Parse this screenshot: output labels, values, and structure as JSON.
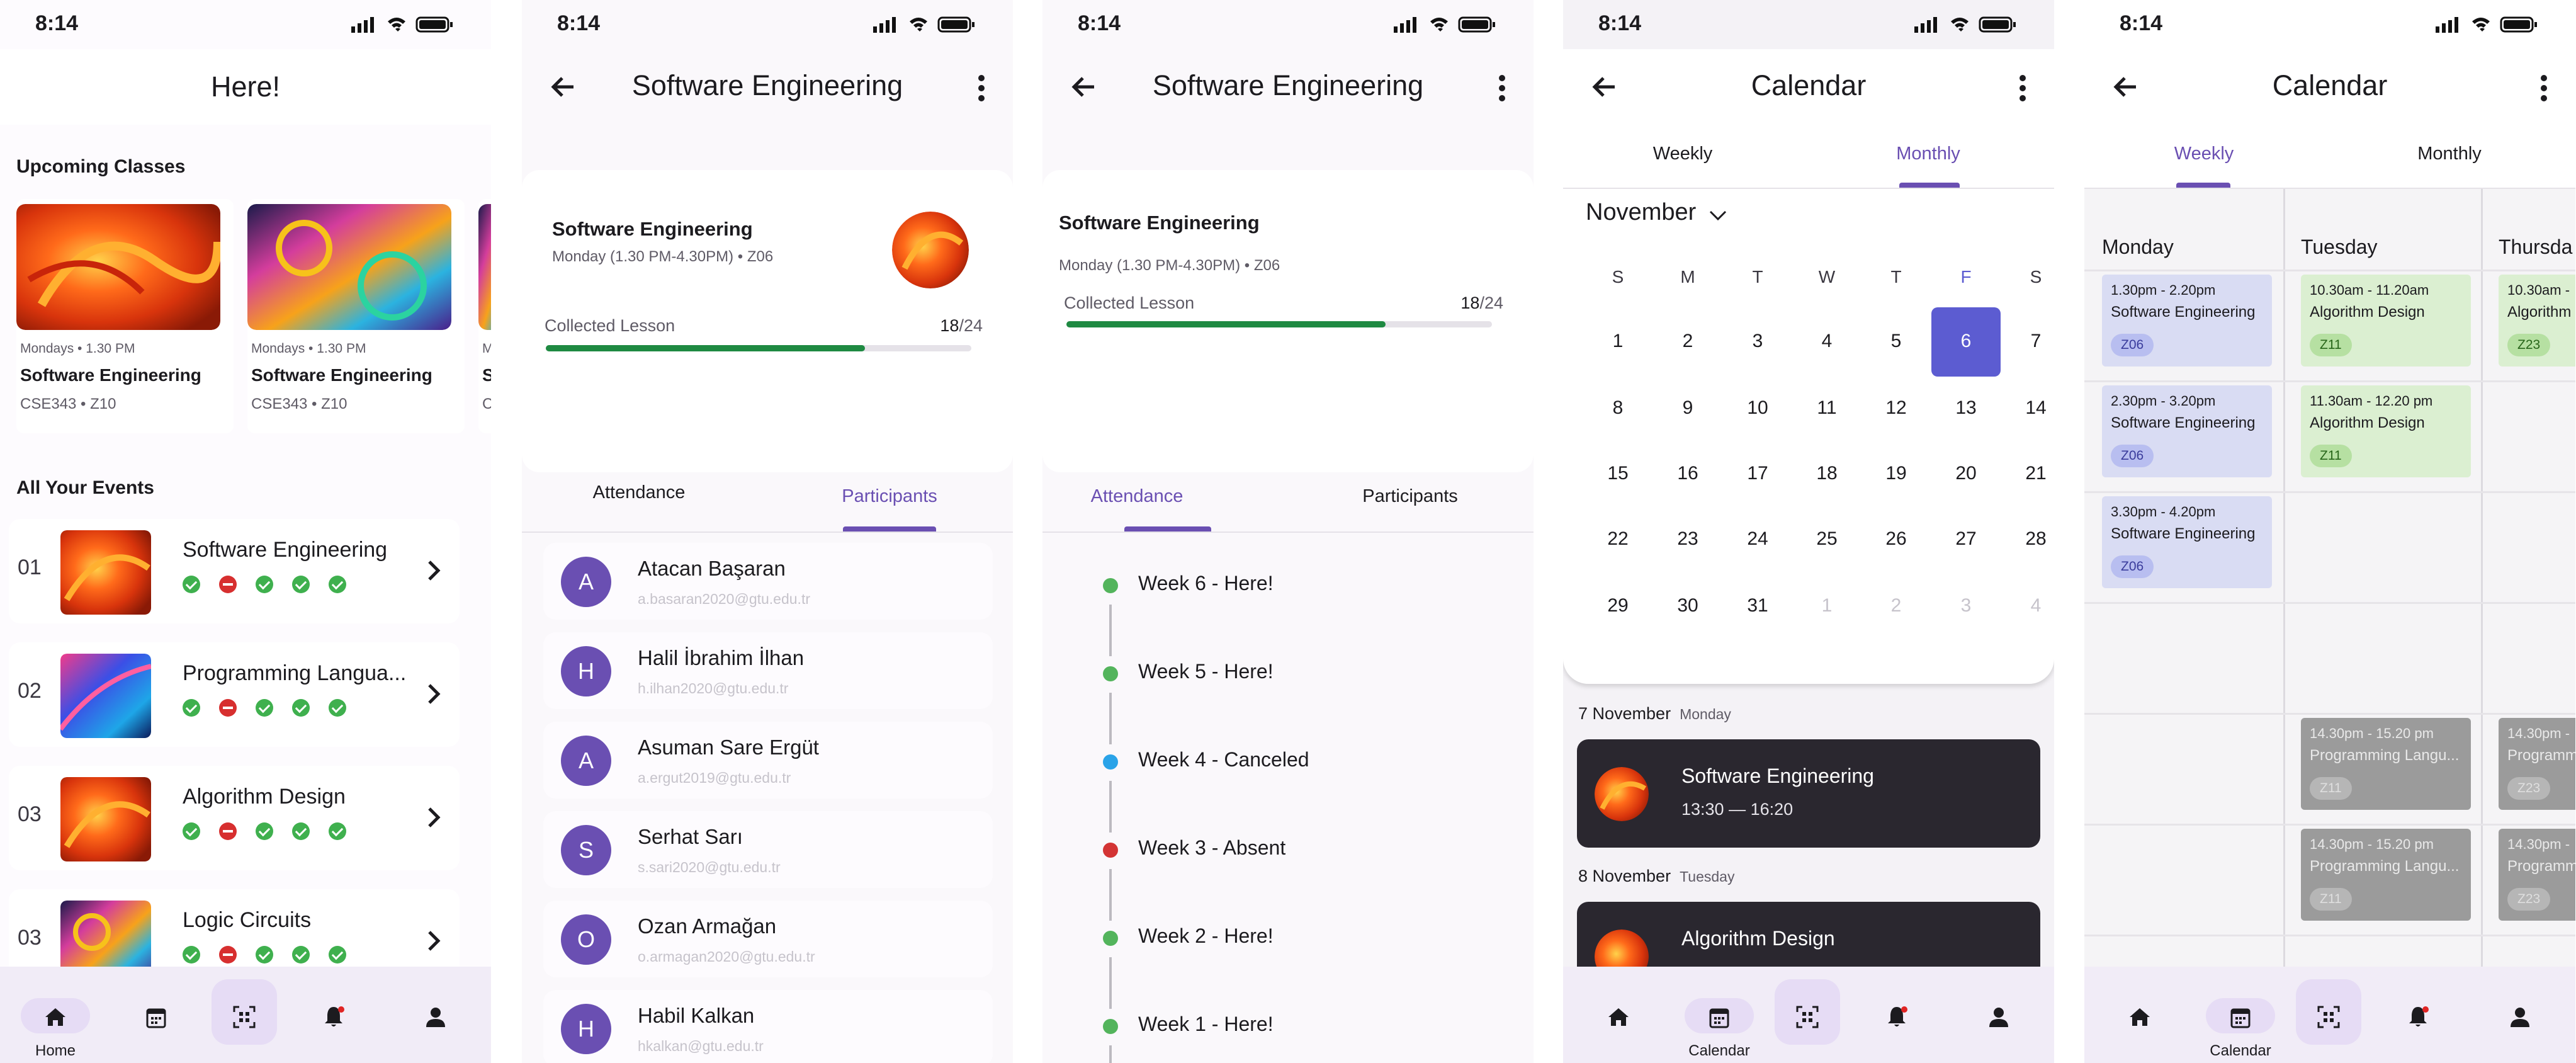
{
  "status_time": "8:14",
  "nav": {
    "home": "Home",
    "calendar": "Calendar"
  },
  "screen1": {
    "title": "Here!",
    "upcoming_title": "Upcoming Classes",
    "events_title": "All Your Events",
    "upcoming": [
      {
        "time": "Mondays • 1.30 PM",
        "name": "Software Engineering",
        "code": "CSE343 • Z10"
      },
      {
        "time": "Mondays • 1.30 PM",
        "name": "Software Engineering",
        "code": "CSE343 • Z10"
      },
      {
        "time": "M",
        "name": "S",
        "code": "C"
      }
    ],
    "events": [
      {
        "num": "01",
        "name": "Software Engineering",
        "marks": [
          "ok",
          "no",
          "ok",
          "ok",
          "ok"
        ]
      },
      {
        "num": "02",
        "name": "Programming Langua...",
        "marks": [
          "ok",
          "no",
          "ok",
          "ok",
          "ok"
        ]
      },
      {
        "num": "03",
        "name": "Algorithm Design",
        "marks": [
          "ok",
          "no",
          "ok",
          "ok",
          "ok"
        ]
      },
      {
        "num": "03",
        "name": "Logic Circuits",
        "marks": [
          "ok",
          "no",
          "ok",
          "ok",
          "ok"
        ]
      }
    ]
  },
  "course": {
    "title": "Software Engineering",
    "name": "Software Engineering",
    "schedule": "Monday (1.30 PM-4.30PM) • Z06",
    "collected_label": "Collected Lesson",
    "collected": "18",
    "total": "/24",
    "progress": 0.75
  },
  "tabs": {
    "attendance": "Attendance",
    "participants": "Participants"
  },
  "participants": [
    {
      "initial": "A",
      "name": "Atacan Başaran",
      "email": "a.basaran2020@gtu.edu.tr"
    },
    {
      "initial": "H",
      "name": "Halil İbrahim İlhan",
      "email": "h.ilhan2020@gtu.edu.tr"
    },
    {
      "initial": "A",
      "name": "Asuman Sare Ergüt",
      "email": "a.ergut2019@gtu.edu.tr"
    },
    {
      "initial": "S",
      "name": "Serhat Sarı",
      "email": "s.sari2020@gtu.edu.tr"
    },
    {
      "initial": "O",
      "name": "Ozan Armağan",
      "email": "o.armagan2020@gtu.edu.tr"
    },
    {
      "initial": "H",
      "name": "Habil Kalkan",
      "email": "hkalkan@gtu.edu.tr"
    }
  ],
  "attendance": [
    {
      "label": "Week 6 - Here!",
      "status": "here",
      "color": "#53b45c"
    },
    {
      "label": "Week 5 - Here!",
      "status": "here",
      "color": "#53b45c"
    },
    {
      "label": "Week 4 - Canceled",
      "status": "canceled",
      "color": "#2aa3e8"
    },
    {
      "label": "Week 3 - Absent",
      "status": "absent",
      "color": "#d33434"
    },
    {
      "label": "Week 2 - Here!",
      "status": "here",
      "color": "#53b45c"
    },
    {
      "label": "Week 1 - Here!",
      "status": "here",
      "color": "#53b45c"
    }
  ],
  "calendar": {
    "title": "Calendar",
    "tab_weekly": "Weekly",
    "tab_monthly": "Monthly",
    "month": "November",
    "weekdays": [
      "S",
      "M",
      "T",
      "W",
      "T",
      "F",
      "S"
    ],
    "weeks": [
      [
        "1",
        "2",
        "3",
        "4",
        "5",
        "6",
        "7"
      ],
      [
        "8",
        "9",
        "10",
        "11",
        "12",
        "13",
        "14"
      ],
      [
        "15",
        "16",
        "17",
        "18",
        "19",
        "20",
        "21"
      ],
      [
        "22",
        "23",
        "24",
        "25",
        "26",
        "27",
        "28"
      ],
      [
        "29",
        "30",
        "31",
        "1",
        "2",
        "3",
        "4"
      ]
    ],
    "selected": "6",
    "agenda": [
      {
        "date": "7 November",
        "weekday": "Monday",
        "name": "Software Engineering",
        "time": "13:30 — 16:20"
      },
      {
        "date": "8 November",
        "weekday": "Tuesday",
        "name": "Algorithm Design",
        "time": ""
      }
    ]
  },
  "weekly": {
    "days": [
      "Monday",
      "Tuesday",
      "Thursda"
    ],
    "slots": [
      {
        "day": 0,
        "row": 0,
        "time": "1.30pm - 2.20pm",
        "name": "Software Engineering",
        "room": "Z06",
        "color": "blue"
      },
      {
        "day": 0,
        "row": 1,
        "time": "2.30pm - 3.20pm",
        "name": "Software Engineering",
        "room": "Z06",
        "color": "blue"
      },
      {
        "day": 0,
        "row": 2,
        "time": "3.30pm - 4.20pm",
        "name": "Software Engineering",
        "room": "Z06",
        "color": "blue"
      },
      {
        "day": 1,
        "row": 0,
        "time": "10.30am - 11.20am",
        "name": "Algorithm Design",
        "room": "Z11",
        "color": "green"
      },
      {
        "day": 1,
        "row": 1,
        "time": "11.30am - 12.20 pm",
        "name": "Algorithm Design",
        "room": "Z11",
        "color": "green"
      },
      {
        "day": 1,
        "row": 4,
        "time": "14.30pm - 15.20 pm",
        "name": "Programming Langu...",
        "room": "Z11",
        "color": "gray"
      },
      {
        "day": 1,
        "row": 5,
        "time": "14.30pm - 15.20 pm",
        "name": "Programming Langu...",
        "room": "Z11",
        "color": "gray"
      },
      {
        "day": 2,
        "row": 0,
        "time": "10.30am -",
        "name": "Algorithm",
        "room": "Z23",
        "color": "green"
      },
      {
        "day": 2,
        "row": 4,
        "time": "14.30pm -",
        "name": "Programm",
        "room": "Z23",
        "color": "gray"
      },
      {
        "day": 2,
        "row": 5,
        "time": "14.30pm -",
        "name": "Programm",
        "room": "Z23",
        "color": "gray"
      }
    ]
  }
}
